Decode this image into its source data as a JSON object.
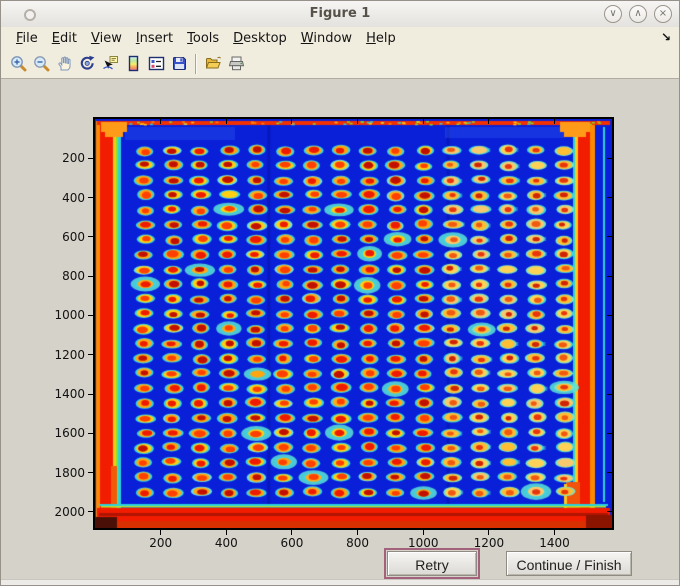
{
  "window": {
    "title": "Figure 1",
    "controls": {
      "minimize": "∨",
      "maximize": "∧",
      "close": "×"
    }
  },
  "menu": {
    "items": [
      {
        "label": "File"
      },
      {
        "label": "Edit"
      },
      {
        "label": "View"
      },
      {
        "label": "Insert"
      },
      {
        "label": "Tools"
      },
      {
        "label": "Desktop"
      },
      {
        "label": "Window"
      },
      {
        "label": "Help"
      }
    ],
    "dock_arrow": "↘"
  },
  "toolbar": {
    "icons": [
      "zoom-in",
      "zoom-out",
      "pan-hand",
      "rotate-3d",
      "data-cursor",
      "insert-colorbar",
      "insert-legend",
      "save-figure",
      "open-file",
      "print-figure"
    ]
  },
  "buttons": {
    "retry": "Retry",
    "continue_finish": "Continue / Finish"
  },
  "chart_data": {
    "type": "heatmap",
    "description": "Microarray plate scan rendered with jet colormap: 24 rows x 16 columns of spots (red cores, yellow-orange rings, cyan halos) on a deep blue field, framed by red border bands with orange corner notches",
    "colormap": "jet",
    "x_range": [
      0,
      1575
    ],
    "y_range": [
      0,
      2082
    ],
    "x_ticks": [
      200,
      400,
      600,
      800,
      1000,
      1200,
      1400
    ],
    "y_ticks": [
      200,
      400,
      600,
      800,
      1000,
      1200,
      1400,
      1600,
      1800,
      2000
    ],
    "grid": {
      "rows": 24,
      "cols": 16,
      "first_col_frac": 0.096,
      "col_spacing_frac": 0.0541,
      "first_row_frac": 0.0775,
      "row_spacing_frac": 0.0363
    },
    "colors": {
      "field": "#0a1fd8",
      "halo_cyan": "#38d8e4",
      "halo_teal": "#74e8cc",
      "ring_yellow": "#ffcf12",
      "ring_orange": "#ffab19",
      "core_red": "#ee1b00",
      "core_dark": "#c21000",
      "border_red": "#f21c00",
      "border_orange": "#ff8a00",
      "corner_orange": "#ff9b18",
      "cyan_line": "#2cd2da",
      "bottom_dark": "#b01400"
    },
    "seed": 11
  }
}
